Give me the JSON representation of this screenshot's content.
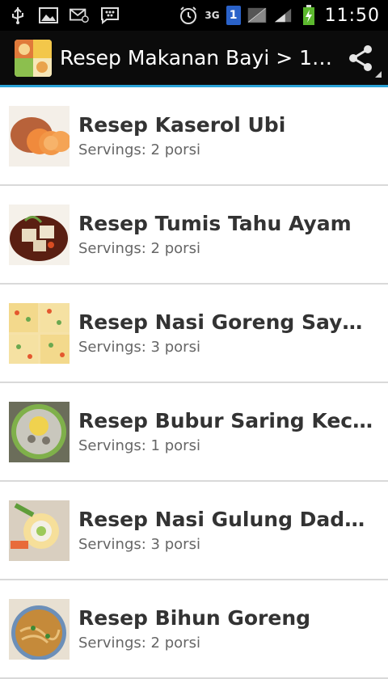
{
  "status_bar": {
    "time": "11:50",
    "network": "3G",
    "sim": "1"
  },
  "action_bar": {
    "title": "Resep Makanan Bayi > 1…"
  },
  "recipes": [
    {
      "title": "Resep Kaserol Ubi",
      "servings": "Servings: 2 porsi"
    },
    {
      "title": "Resep Tumis Tahu Ayam",
      "servings": "Servings: 2 porsi"
    },
    {
      "title": "Resep Nasi Goreng Sayuran",
      "servings": "Servings: 3 porsi"
    },
    {
      "title": "Resep Bubur Saring Kecap",
      "servings": "Servings: 1 porsi"
    },
    {
      "title": "Resep Nasi Gulung Dadar So…",
      "servings": "Servings: 3 porsi"
    },
    {
      "title": "Resep Bihun Goreng",
      "servings": "Servings: 2 porsi"
    }
  ],
  "colors": {
    "accent": "#2aa3d8",
    "status_bar_bg": "#000000",
    "action_bar_bg": "#0b0b0b",
    "title_text": "#333333",
    "subtitle_text": "#666666"
  }
}
